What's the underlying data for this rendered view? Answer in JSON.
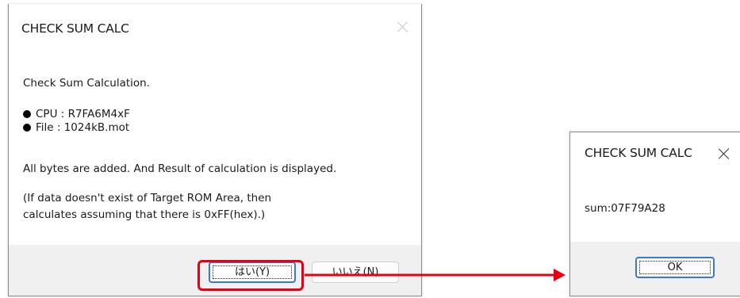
{
  "main_dialog": {
    "title": "CHECK SUM CALC",
    "heading": "Check Sum Calculation.",
    "cpu_line": "CPU  : R7FA6M4xF",
    "file_line": "File : 1024kB.mot",
    "description": "All bytes are added.  And Result of calculation is displayed.",
    "note_line1": "(If data doesn't exist of Target ROM Area, then",
    "note_line2": "calculates assuming that there is 0xFF(hex).)",
    "yes_button": "はい(Y)",
    "no_button": "いいえ(N)"
  },
  "result_dialog": {
    "title": "CHECK SUM CALC",
    "sum_text": "sum:07F79A28",
    "ok_button": "OK"
  },
  "icons": {
    "close": "close-icon",
    "bullet": "bullet-icon"
  },
  "colors": {
    "highlight": "#e60012",
    "primary_button_border": "#3c78d0",
    "footer_background": "#f0f0f0"
  }
}
